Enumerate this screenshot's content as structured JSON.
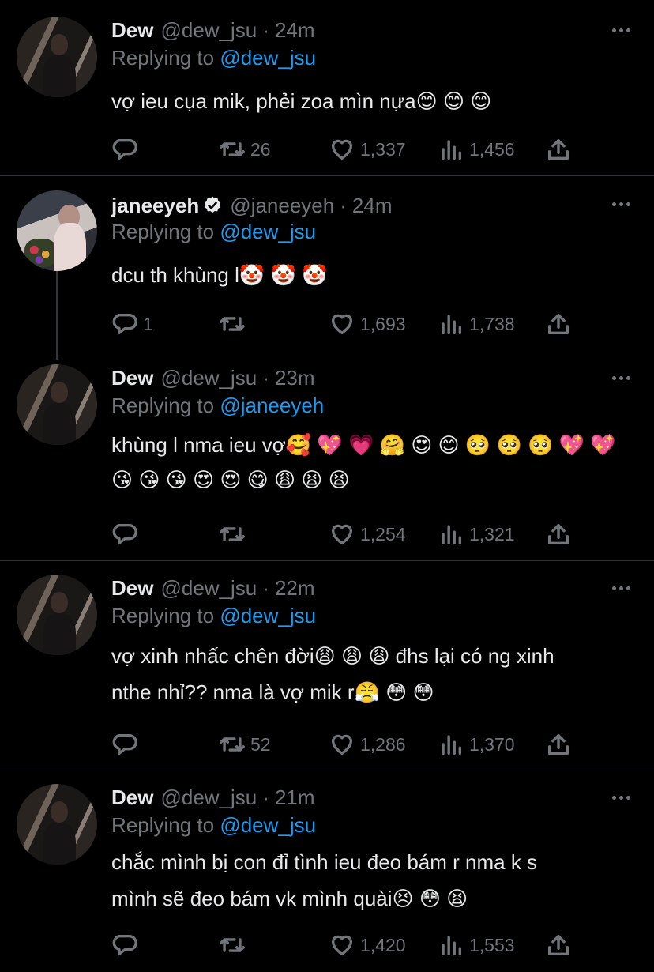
{
  "tweets": [
    {
      "name": "Dew",
      "handle": "@dew_jsu",
      "dot": "·",
      "time": "24m",
      "replying_prefix": "Replying to ",
      "replying_to": "@dew_jsu",
      "text": "vợ ieu cụa mik, phẻi zoa mìn nựa😊 😊 😊",
      "reply_count": "",
      "retweet_count": "26",
      "like_count": "1,337",
      "view_count": "1,456"
    },
    {
      "name": "janeeyeh",
      "handle": "@janeeyeh",
      "dot": "·",
      "time": "24m",
      "replying_prefix": "Replying to ",
      "replying_to": "@dew_jsu",
      "text": "dcu th khùng l🤡 🤡 🤡",
      "reply_count": "1",
      "retweet_count": "",
      "like_count": "1,693",
      "view_count": "1,738"
    },
    {
      "name": "Dew",
      "handle": "@dew_jsu",
      "dot": "·",
      "time": "23m",
      "replying_prefix": "Replying to ",
      "replying_to": "@janeeyeh",
      "text": "khùng l nma ieu vợ🥰 💖 💗 🤗 😍 😊 🥺 🥺 🥺 💖 💖\n😘 😘 😘 😍 😍 😋 😩 😫 😫",
      "reply_count": "",
      "retweet_count": "",
      "like_count": "1,254",
      "view_count": "1,321"
    },
    {
      "name": "Dew",
      "handle": "@dew_jsu",
      "dot": "·",
      "time": "22m",
      "replying_prefix": "Replying to ",
      "replying_to": "@dew_jsu",
      "text": "vợ xinh nhấc chên đời😩 😩 😩 đhs lại có ng xinh\nnthe nhỉ?? nma là vợ mik r😤 😳 😳",
      "reply_count": "",
      "retweet_count": "52",
      "like_count": "1,286",
      "view_count": "1,370"
    },
    {
      "name": "Dew",
      "handle": "@dew_jsu",
      "dot": "·",
      "time": "21m",
      "replying_prefix": "Replying to ",
      "replying_to": "@dew_jsu",
      "text": "chắc mình bị con đỉ tình ieu đeo bám r nma k s\nmình sẽ đeo bám vk mình quài😣 😳 😫",
      "reply_count": "",
      "retweet_count": "",
      "like_count": "1,420",
      "view_count": "1,553"
    }
  ],
  "icons": {
    "reply": "reply-icon",
    "retweet": "retweet-icon",
    "like": "heart-icon",
    "views": "views-icon",
    "share": "share-icon",
    "more": "more-icon",
    "verified": "verified-badge-icon"
  },
  "colors": {
    "background": "#000000",
    "text": "#e7e9ea",
    "muted": "#71767b",
    "link": "#1d9bf0",
    "divider": "#2f3336"
  }
}
